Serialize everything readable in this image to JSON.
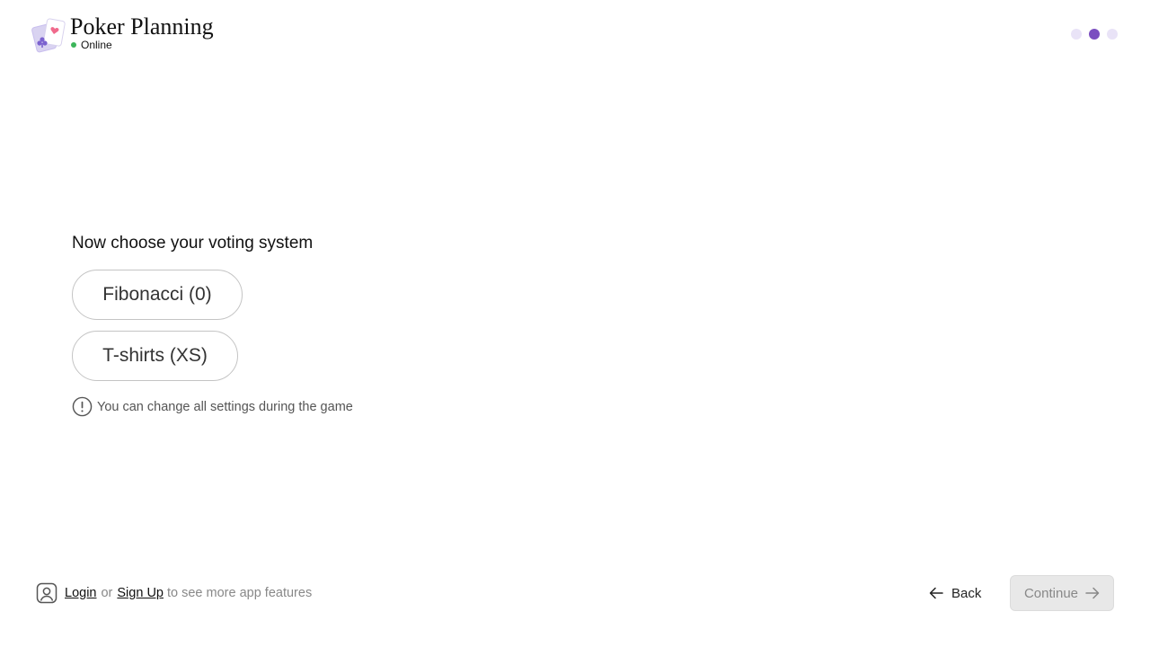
{
  "header": {
    "brand_title": "Poker Planning",
    "status_text": "Online",
    "colors": {
      "status": "#3cb55a",
      "accent": "#7b4fc0",
      "step_inactive": "#e9e3f7"
    },
    "steps": {
      "total": 3,
      "current": 2
    }
  },
  "main": {
    "question": "Now choose your voting system",
    "options": [
      {
        "label": "Fibonacci (0)"
      },
      {
        "label": "T-shirts (XS)"
      }
    ],
    "note": "You can change all settings during the game",
    "note_icon": "exclamation-circle-icon"
  },
  "footer": {
    "user_icon": "user-square-icon",
    "login_label": "Login",
    "or_text": "or",
    "signup_label": "Sign Up",
    "suffix_text": "to see more app features",
    "back_label": "Back",
    "back_icon": "arrow-left-icon",
    "continue_label": "Continue",
    "continue_icon": "arrow-right-icon"
  }
}
